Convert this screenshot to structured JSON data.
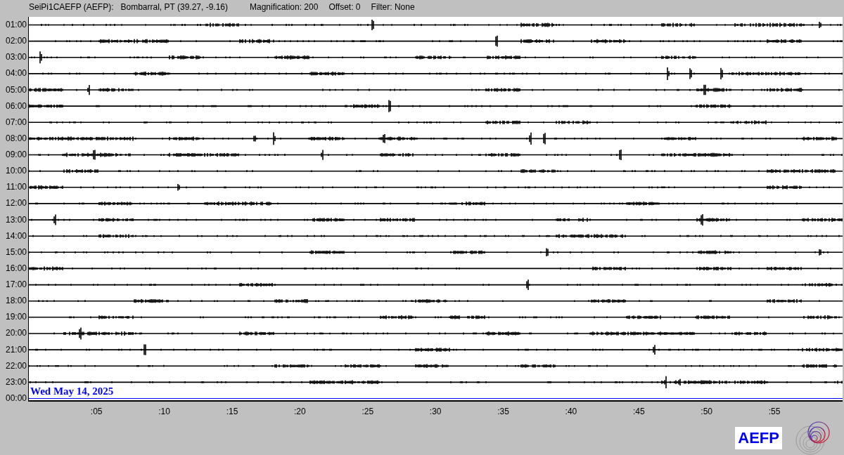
{
  "header": {
    "station": "SeiPi1CAEFP (AEFP):",
    "location": "Bombarral, PT (39.27, -9.16)",
    "magnification": "Magnification: 200",
    "offset": "Offset: 0",
    "filter": "Filter: None"
  },
  "rows": [
    {
      "label": "01:00",
      "kind": "trace"
    },
    {
      "label": "02:00",
      "kind": "trace"
    },
    {
      "label": "03:00",
      "kind": "trace"
    },
    {
      "label": "04:00",
      "kind": "trace"
    },
    {
      "label": "05:00",
      "kind": "trace"
    },
    {
      "label": "06:00",
      "kind": "trace"
    },
    {
      "label": "07:00",
      "kind": "trace"
    },
    {
      "label": "08:00",
      "kind": "trace"
    },
    {
      "label": "09:00",
      "kind": "trace"
    },
    {
      "label": "10:00",
      "kind": "trace"
    },
    {
      "label": "11:00",
      "kind": "trace"
    },
    {
      "label": "12:00",
      "kind": "trace"
    },
    {
      "label": "13:00",
      "kind": "trace"
    },
    {
      "label": "14:00",
      "kind": "trace"
    },
    {
      "label": "15:00",
      "kind": "trace"
    },
    {
      "label": "16:00",
      "kind": "trace"
    },
    {
      "label": "17:00",
      "kind": "trace"
    },
    {
      "label": "18:00",
      "kind": "trace"
    },
    {
      "label": "19:00",
      "kind": "trace"
    },
    {
      "label": "20:00",
      "kind": "trace"
    },
    {
      "label": "21:00",
      "kind": "trace"
    },
    {
      "label": "22:00",
      "kind": "trace"
    },
    {
      "label": "23:00",
      "kind": "trace"
    },
    {
      "label": "00:00",
      "kind": "current",
      "date": "Wed May 14, 2025"
    }
  ],
  "ticks": [
    ":05",
    ":10",
    ":15",
    ":20",
    ":25",
    ":30",
    ":35",
    ":40",
    ":45",
    ":50",
    ":55"
  ],
  "logo": {
    "text": "AEFP"
  }
}
